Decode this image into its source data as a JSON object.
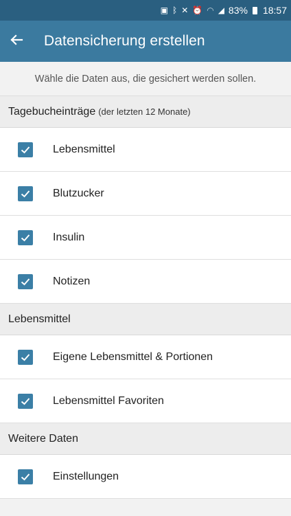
{
  "status_bar": {
    "battery_percent": "83%",
    "time": "18:57",
    "icons": [
      "sd-card-icon",
      "bluetooth-icon",
      "mute-icon",
      "alarm-icon",
      "wifi-icon",
      "signal-icon",
      "battery-icon"
    ]
  },
  "app_bar": {
    "back_icon": "arrow-left-icon",
    "title": "Datensicherung erstellen"
  },
  "intro_text": "Wähle die Daten aus, die gesichert werden sollen.",
  "sections": [
    {
      "title": "Tagebucheinträge",
      "subtitle": "(der letzten 12 Monate)",
      "items": [
        {
          "label": "Lebensmittel",
          "checked": true
        },
        {
          "label": "Blutzucker",
          "checked": true
        },
        {
          "label": "Insulin",
          "checked": true
        },
        {
          "label": "Notizen",
          "checked": true
        }
      ]
    },
    {
      "title": "Lebensmittel",
      "items": [
        {
          "label": "Eigene Lebensmittel & Portionen",
          "checked": true
        },
        {
          "label": "Lebensmittel Favoriten",
          "checked": true
        }
      ]
    },
    {
      "title": "Weitere Daten",
      "items": [
        {
          "label": "Einstellungen",
          "checked": true
        }
      ]
    }
  ],
  "colors": {
    "status_bar": "#2a5f80",
    "app_bar": "#3b7a9f",
    "checkbox": "#3b7fa6"
  }
}
